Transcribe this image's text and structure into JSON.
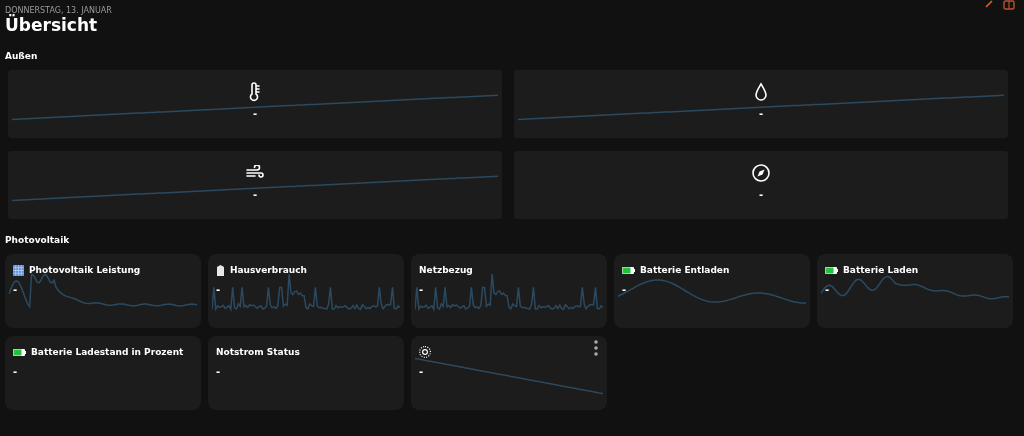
{
  "header": {
    "date": "DONNERSTAG, 13. JANUAR",
    "title": "Übersicht"
  },
  "sections": [
    {
      "title": "Außen",
      "cards": [
        {
          "kind": "thermometer",
          "value": "-"
        },
        {
          "kind": "drop",
          "value": "-"
        },
        {
          "kind": "wind",
          "value": "-"
        },
        {
          "kind": "compass",
          "value": "-"
        }
      ]
    },
    {
      "title": "Photovoltaik",
      "cards": [
        {
          "kind": "solar",
          "name": "Photovoltaik Leistung",
          "value": "-"
        },
        {
          "kind": "house",
          "name": "Hausverbrauch",
          "value": "-"
        },
        {
          "kind": "plain",
          "name": "Netzbezug",
          "value": "-"
        },
        {
          "kind": "battery",
          "name": "Batterie Entladen",
          "value": "-"
        },
        {
          "kind": "battery",
          "name": "Batterie Laden",
          "value": "-"
        },
        {
          "kind": "battery",
          "name": "Batterie Ladestand in Prozent",
          "value": "-"
        },
        {
          "kind": "plain",
          "name": "Notstrom Status",
          "value": "-"
        },
        {
          "kind": "sun",
          "value": "-",
          "menu": true
        }
      ]
    }
  ]
}
